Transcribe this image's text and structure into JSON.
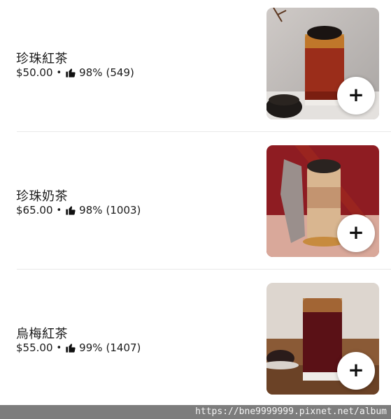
{
  "menu": {
    "items": [
      {
        "name": "珍珠紅茶",
        "price": "$50.00",
        "rating": "98%",
        "count": "(549)",
        "photo_icon": "bubble-tea-photo"
      },
      {
        "name": "珍珠奶茶",
        "price": "$65.00",
        "rating": "98%",
        "count": "(1003)",
        "photo_icon": "milk-tea-photo"
      },
      {
        "name": "烏梅紅茶",
        "price": "$55.00",
        "rating": "99%",
        "count": "(1407)",
        "photo_icon": "plum-tea-photo"
      }
    ],
    "separator": "•",
    "add_label": "+"
  },
  "watermark": {
    "text": "https://bne9999999.pixnet.net/album"
  }
}
